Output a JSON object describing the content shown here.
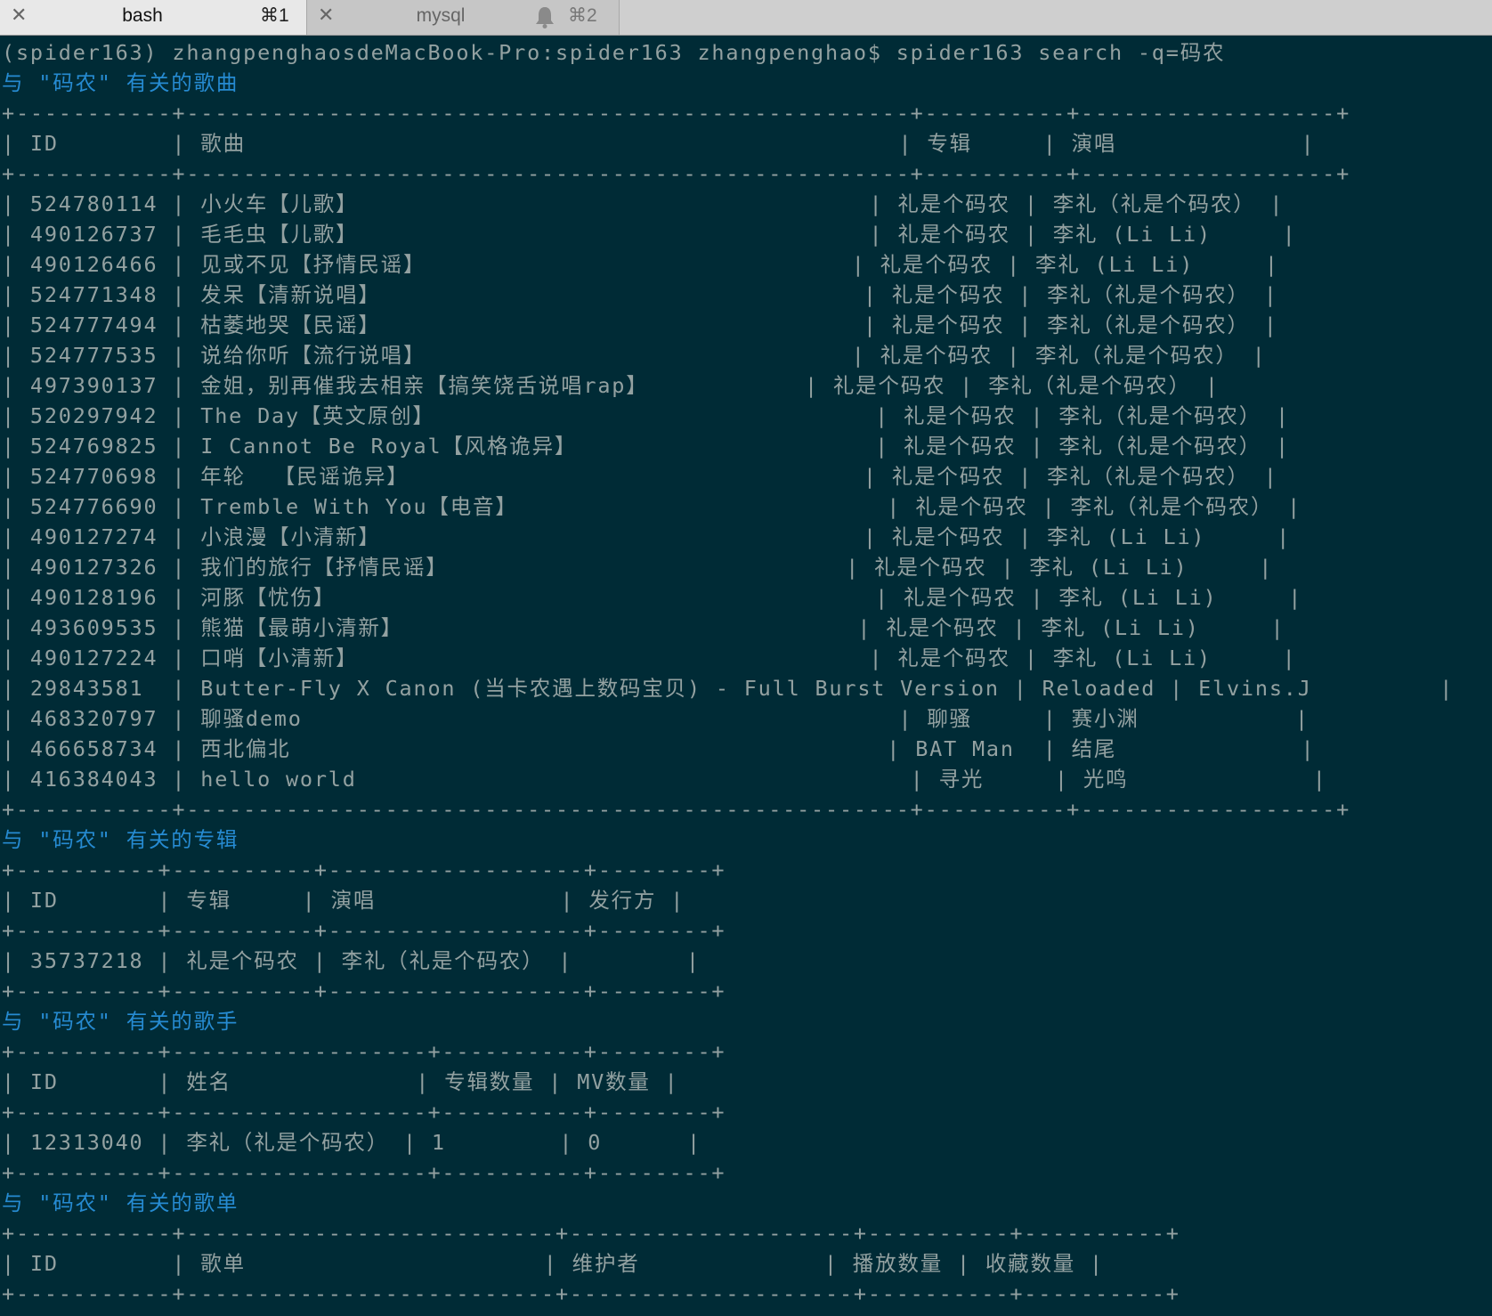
{
  "tabs": [
    {
      "close": "✕",
      "title": "bash",
      "shortcut": "⌘1",
      "active": true
    },
    {
      "close": "✕",
      "title": "mysql",
      "shortcut": "⌘2",
      "active": false,
      "icon": "bell-icon"
    }
  ],
  "colors": {
    "terminal_bg": "#002b36",
    "text": "#93a1a1",
    "heading": "#268bd2",
    "tabbar_bg": "#cfcfcf"
  },
  "terminal": {
    "lines": [
      {
        "type": "prompt",
        "text": "(spider163) zhangpenghaosdeMacBook-Pro:spider163 zhangpenghao$ spider163 search -q=码农"
      },
      {
        "type": "heading",
        "text": "与 \"码农\" 有关的歌曲"
      },
      {
        "type": "text",
        "text": "+-----------+---------------------------------------------------+----------+------------------+"
      },
      {
        "type": "text",
        "text": "| ID        | 歌曲                                              | 专辑     | 演唱             |"
      },
      {
        "type": "text",
        "text": "+-----------+---------------------------------------------------+----------+------------------+"
      },
      {
        "type": "text",
        "text": "| 524780114 | 小火车【儿歌】                                    | 礼是个码农 | 李礼（礼是个码农） |"
      },
      {
        "type": "text",
        "text": "| 490126737 | 毛毛虫【儿歌】                                    | 礼是个码农 | 李礼 (Li Li)     |"
      },
      {
        "type": "text",
        "text": "| 490126466 | 见或不见【抒情民谣】                              | 礼是个码农 | 李礼 (Li Li)     |"
      },
      {
        "type": "text",
        "text": "| 524771348 | 发呆【清新说唱】                                  | 礼是个码农 | 李礼（礼是个码农） |"
      },
      {
        "type": "text",
        "text": "| 524777494 | 枯萎地哭【民谣】                                  | 礼是个码农 | 李礼（礼是个码农） |"
      },
      {
        "type": "text",
        "text": "| 524777535 | 说给你听【流行说唱】                              | 礼是个码农 | 李礼（礼是个码农） |"
      },
      {
        "type": "text",
        "text": "| 497390137 | 金姐，别再催我去相亲【搞笑饶舌说唱rap】           | 礼是个码农 | 李礼（礼是个码农） |"
      },
      {
        "type": "text",
        "text": "| 520297942 | The Day【英文原创】                               | 礼是个码农 | 李礼（礼是个码农） |"
      },
      {
        "type": "text",
        "text": "| 524769825 | I Cannot Be Royal【风格诡异】                     | 礼是个码农 | 李礼（礼是个码农） |"
      },
      {
        "type": "text",
        "text": "| 524770698 | 年轮  【民谣诡异】                                | 礼是个码农 | 李礼（礼是个码农） |"
      },
      {
        "type": "text",
        "text": "| 524776690 | Tremble With You【电音】                          | 礼是个码农 | 李礼（礼是个码农） |"
      },
      {
        "type": "text",
        "text": "| 490127274 | 小浪漫【小清新】                                  | 礼是个码农 | 李礼 (Li Li)     |"
      },
      {
        "type": "text",
        "text": "| 490127326 | 我们的旅行【抒情民谣】                            | 礼是个码农 | 李礼 (Li Li)     |"
      },
      {
        "type": "text",
        "text": "| 490128196 | 河豚【忧伤】                                      | 礼是个码农 | 李礼 (Li Li)     |"
      },
      {
        "type": "text",
        "text": "| 493609535 | 熊猫【最萌小清新】                                | 礼是个码农 | 李礼 (Li Li)     |"
      },
      {
        "type": "text",
        "text": "| 490127224 | 口哨【小清新】                                    | 礼是个码农 | 李礼 (Li Li)     |"
      },
      {
        "type": "text",
        "text": "| 29843581  | Butter-Fly X Canon (当卡农遇上数码宝贝) - Full Burst Version | Reloaded | Elvins.J         |"
      },
      {
        "type": "text",
        "text": "| 468320797 | 聊骚demo                                          | 聊骚     | 赛小渊           |"
      },
      {
        "type": "text",
        "text": "| 466658734 | 西北偏北                                          | BAT Man  | 结尾             |"
      },
      {
        "type": "text",
        "text": "| 416384043 | hello world                                       | 寻光     | 光鸣             |"
      },
      {
        "type": "text",
        "text": "+-----------+---------------------------------------------------+----------+------------------+"
      },
      {
        "type": "heading",
        "text": "与 \"码农\" 有关的专辑"
      },
      {
        "type": "text",
        "text": "+----------+----------+------------------+--------+"
      },
      {
        "type": "text",
        "text": "| ID       | 专辑     | 演唱             | 发行方 |"
      },
      {
        "type": "text",
        "text": "+----------+----------+------------------+--------+"
      },
      {
        "type": "text",
        "text": "| 35737218 | 礼是个码农 | 李礼（礼是个码农） |        |"
      },
      {
        "type": "text",
        "text": "+----------+----------+------------------+--------+"
      },
      {
        "type": "heading",
        "text": "与 \"码农\" 有关的歌手"
      },
      {
        "type": "text",
        "text": "+----------+------------------+----------+--------+"
      },
      {
        "type": "text",
        "text": "| ID       | 姓名             | 专辑数量 | MV数量 |"
      },
      {
        "type": "text",
        "text": "+----------+------------------+----------+--------+"
      },
      {
        "type": "text",
        "text": "| 12313040 | 李礼（礼是个码农） | 1        | 0      |"
      },
      {
        "type": "text",
        "text": "+----------+------------------+----------+--------+"
      },
      {
        "type": "heading",
        "text": "与 \"码农\" 有关的歌单"
      },
      {
        "type": "text",
        "text": "+-----------+--------------------------+--------------------+----------+----------+"
      },
      {
        "type": "text",
        "text": "| ID        | 歌单                     | 维护者             | 播放数量 | 收藏数量 |"
      },
      {
        "type": "text",
        "text": "+-----------+--------------------------+--------------------+----------+----------+"
      }
    ]
  }
}
